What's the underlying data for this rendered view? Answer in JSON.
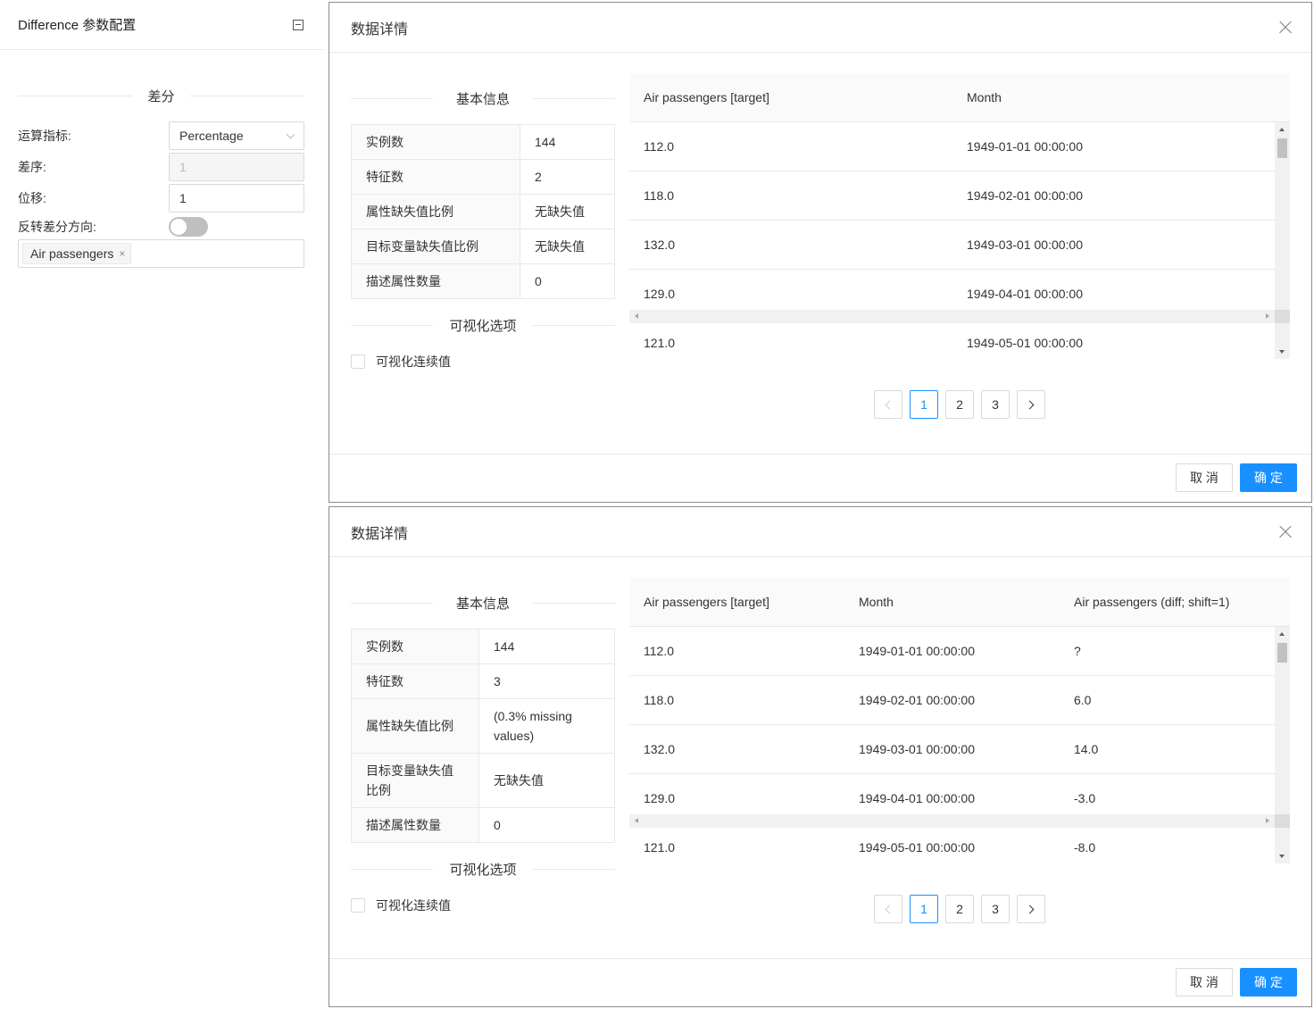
{
  "config_panel": {
    "title": "Difference 参数配置",
    "section_title": "差分",
    "metric_label": "运算指标:",
    "metric_value": "Percentage",
    "order_label": "差序:",
    "order_value": "1",
    "shift_label": "位移:",
    "shift_value": "1",
    "reverse_label": "反转差分方向:",
    "reverse_on": false,
    "selected_tag": "Air passengers",
    "tag_close": "×"
  },
  "dialog1": {
    "title": "数据详情",
    "basic_info_title": "基本信息",
    "info": [
      {
        "key": "实例数",
        "value": "144"
      },
      {
        "key": "特征数",
        "value": "2"
      },
      {
        "key": "属性缺失值比例",
        "value": "无缺失值"
      },
      {
        "key": "目标变量缺失值比例",
        "value": "无缺失值"
      },
      {
        "key": "描述属性数量",
        "value": "0"
      }
    ],
    "vis_title": "可视化选项",
    "vis_checkbox_label": "可视化连续值",
    "columns": [
      "Air passengers [target]",
      "Month"
    ],
    "rows": [
      [
        "112.0",
        "1949-01-01 00:00:00"
      ],
      [
        "118.0",
        "1949-02-01 00:00:00"
      ],
      [
        "132.0",
        "1949-03-01 00:00:00"
      ],
      [
        "129.0",
        "1949-04-01 00:00:00"
      ],
      [
        "121.0",
        "1949-05-01 00:00:00"
      ]
    ],
    "pages": [
      "1",
      "2",
      "3"
    ],
    "current_page": "1",
    "cancel_label": "取 消",
    "ok_label": "确 定"
  },
  "dialog2": {
    "title": "数据详情",
    "basic_info_title": "基本信息",
    "info": [
      {
        "key": "实例数",
        "value": "144"
      },
      {
        "key": "特征数",
        "value": "3"
      },
      {
        "key": "属性缺失值比例",
        "value": "(0.3% missing values)"
      },
      {
        "key": "目标变量缺失值比例",
        "value": "无缺失值"
      },
      {
        "key": "描述属性数量",
        "value": "0"
      }
    ],
    "vis_title": "可视化选项",
    "vis_checkbox_label": "可视化连续值",
    "columns": [
      "Air passengers [target]",
      "Month",
      "Air passengers (diff; shift=1)"
    ],
    "rows": [
      [
        "112.0",
        "1949-01-01 00:00:00",
        "?"
      ],
      [
        "118.0",
        "1949-02-01 00:00:00",
        "6.0"
      ],
      [
        "132.0",
        "1949-03-01 00:00:00",
        "14.0"
      ],
      [
        "129.0",
        "1949-04-01 00:00:00",
        "-3.0"
      ],
      [
        "121.0",
        "1949-05-01 00:00:00",
        "-8.0"
      ]
    ],
    "pages": [
      "1",
      "2",
      "3"
    ],
    "current_page": "1",
    "cancel_label": "取 消",
    "ok_label": "确 定"
  },
  "colors": {
    "primary": "#1890ff",
    "border": "#d9d9d9",
    "header_bg": "#fafafa"
  }
}
